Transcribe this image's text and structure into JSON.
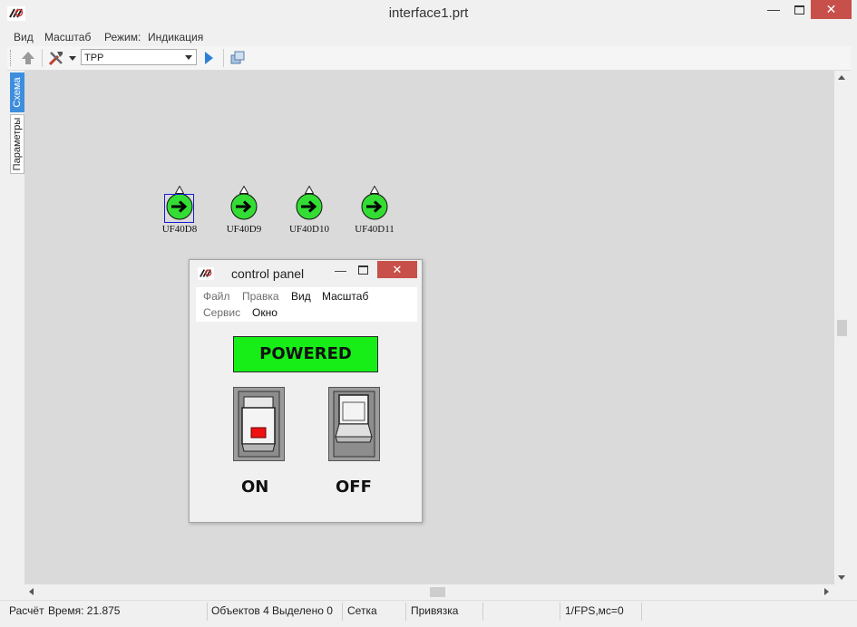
{
  "window": {
    "title": "interface1.prt",
    "min_glyph": "—",
    "close_glyph": "✕"
  },
  "menubar": {
    "items": [
      "Вид",
      "Масштаб",
      "Режим:",
      "Индикация"
    ]
  },
  "toolbar": {
    "selector_value": "TPP"
  },
  "left_tabs": {
    "active": "Схема",
    "inactive": "Параметры"
  },
  "sensors": [
    {
      "label": "UF40D8",
      "selected": true
    },
    {
      "label": "UF40D9",
      "selected": false
    },
    {
      "label": "UF40D10",
      "selected": false
    },
    {
      "label": "UF40D11",
      "selected": false
    }
  ],
  "colors": {
    "sensor_fill": "#33dd33",
    "powered_fill": "#17ee17",
    "close_red": "#c7504a",
    "canvas": "#dadada",
    "active_tab": "#3e8ede"
  },
  "status": {
    "calc": "Расчёт",
    "time": "Время: 21.875",
    "objects": "Объектов 4",
    "selected": "Выделено 0",
    "grid": "Сетка",
    "snap": "Привязка",
    "fps": "1/FPS,мс=0"
  },
  "control_panel": {
    "title": "control panel",
    "min_glyph": "—",
    "close_glyph": "✕",
    "menu": {
      "file": "Файл",
      "edit": "Правка",
      "view": "Вид",
      "scale": "Масштаб",
      "service": "Сервис",
      "window": "Окно"
    },
    "indicator": "POWERED",
    "switch_on_label": "ON",
    "switch_off_label": "OFF"
  }
}
